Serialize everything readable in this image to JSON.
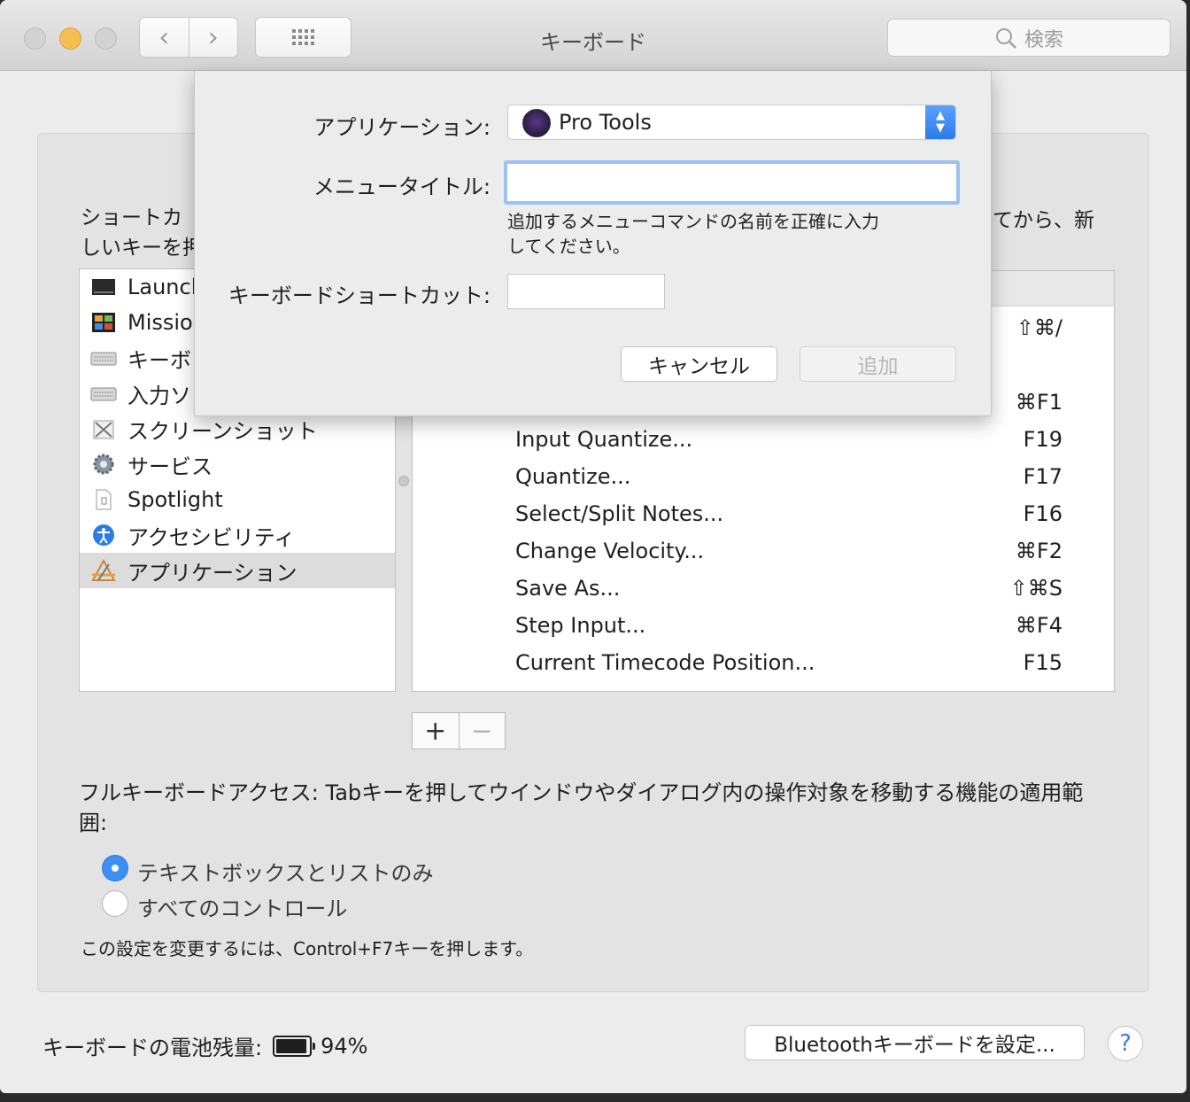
{
  "window": {
    "title": "キーボード"
  },
  "toolbar": {
    "back_glyph": "‹",
    "forward_glyph": "›",
    "search_placeholder": "検索"
  },
  "intro": {
    "line1": "ショートカ",
    "line2": "しいキーを押",
    "line1_right": "てから、新"
  },
  "categories": [
    {
      "label": "Launcl",
      "icon": "launchpad-icon"
    },
    {
      "label": "Missio",
      "icon": "mission-control-icon"
    },
    {
      "label": "キーボ",
      "icon": "keyboard-icon"
    },
    {
      "label": "入力ソ",
      "icon": "input-source-icon"
    },
    {
      "label": "スクリーンショット",
      "icon": "screenshot-icon"
    },
    {
      "label": "サービス",
      "icon": "gear-icon"
    },
    {
      "label": "Spotlight",
      "icon": "spotlight-icon"
    },
    {
      "label": "アクセシビリティ",
      "icon": "accessibility-icon"
    },
    {
      "label": "アプリケーション",
      "icon": "app-icon",
      "selected": true
    }
  ],
  "shortcuts": [
    {
      "name": "",
      "key": "⇧⌘/"
    },
    {
      "name": "",
      "key": "⌘F1"
    },
    {
      "name": "Input Quantize...",
      "key": "F19"
    },
    {
      "name": "Quantize...",
      "key": "F17"
    },
    {
      "name": "Select/Split Notes...",
      "key": "F16"
    },
    {
      "name": "Change Velocity...",
      "key": "⌘F2"
    },
    {
      "name": "Save As...",
      "key": "⇧⌘S"
    },
    {
      "name": "Step Input...",
      "key": "⌘F4"
    },
    {
      "name": "Current Timecode Position...",
      "key": "F15"
    }
  ],
  "list_buttons": {
    "add": "+",
    "remove": "−"
  },
  "full_keyboard_access": {
    "label": "フルキーボードアクセス: Tabキーを押してウインドウやダイアログ内の操作対象を移動する機能の適用範囲:",
    "options": [
      {
        "label": "テキストボックスとリストのみ",
        "selected": true
      },
      {
        "label": "すべてのコントロール",
        "selected": false
      }
    ],
    "note": "この設定を変更するには、Control+F7キーを押します。"
  },
  "battery": {
    "label": "キーボードの電池残量:",
    "percent_text": "94%",
    "level": 0.94
  },
  "bluetooth_button": "Bluetoothキーボードを設定...",
  "help_button": "?",
  "sheet": {
    "app_label": "アプリケーション:",
    "app_value": "Pro Tools",
    "menu_title_label": "メニュータイトル:",
    "menu_title_value": "",
    "hint": "追加するメニューコマンドの名前を正確に入力してください。",
    "shortcut_label": "キーボードショートカット:",
    "shortcut_value": "",
    "cancel": "キャンセル",
    "add": "追加"
  },
  "colors": {
    "accent": "#3d8ef5",
    "focus_ring": "#9cc1f2",
    "window_bg": "#ececec"
  }
}
